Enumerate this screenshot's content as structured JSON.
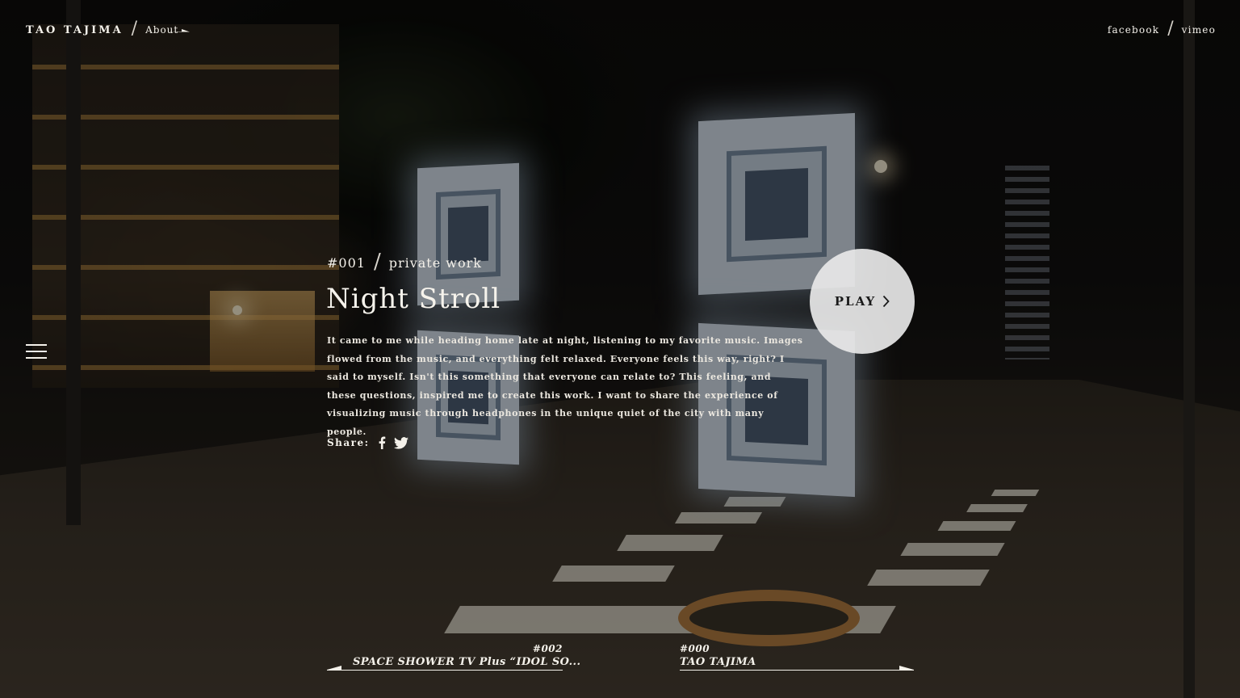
{
  "header": {
    "brand": "TAO TAJIMA",
    "about": "About",
    "social": [
      {
        "label": "facebook"
      },
      {
        "label": "vimeo"
      }
    ]
  },
  "work": {
    "number": "#001",
    "category": "private work",
    "title": "Night Stroll",
    "description": "It came to me while heading home late at night, listening to my favorite music. Images flowed from the music, and everything felt relaxed. Everyone feels this way, right? I said to myself. Isn't this something that everyone can relate to? This feeling, and these questions, inspired me to create this work. I want to share the experience of visualizing music through headphones in the unique quiet of the city with many people.",
    "share_label": "Share:",
    "play_label": "PLAY"
  },
  "pager": {
    "prev": {
      "number": "#002",
      "title": "SPACE SHOWER TV Plus “IDOL SO..."
    },
    "next": {
      "number": "#000",
      "title": "TAO TAJIMA"
    }
  },
  "icons": {
    "menu": "hamburger-menu-icon",
    "facebook": "facebook-icon",
    "twitter": "twitter-icon",
    "play": "chevron-right-icon"
  },
  "colors": {
    "text": "#f4f1ea",
    "play_button_bg": "#e8e8e8",
    "play_text": "#1a1a1a"
  }
}
